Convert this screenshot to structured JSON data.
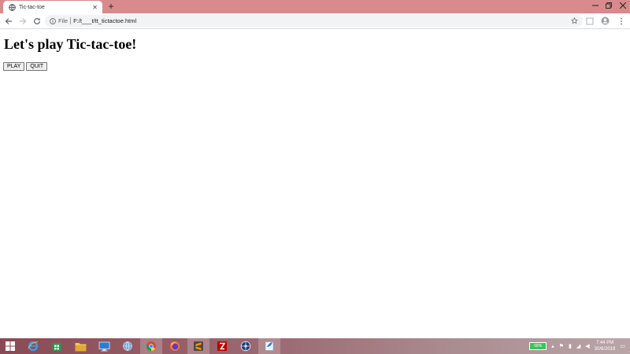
{
  "browser": {
    "tab_title": "Tic-tac-toe",
    "new_tab_symbol": "+",
    "url_scheme": "File",
    "url": "F:/t___t/tt_tictactoe.html"
  },
  "page": {
    "heading": "Let's play Tic-tac-toe!",
    "buttons": {
      "play": "PLAY",
      "quit": "QUIT"
    }
  },
  "taskbar": {
    "battery_percent": "68%",
    "clock_time": "7:44 PM",
    "clock_date": "30/6/2019",
    "apps": [
      "windows-start",
      "internet-explorer",
      "store",
      "file-explorer",
      "remote-desktop",
      "network",
      "chrome",
      "firefox",
      "sublime-text",
      "filezilla",
      "steering",
      "notepad"
    ]
  },
  "colors": {
    "titlebar": "#d98a8c",
    "chrome_bg": "#ffffff",
    "omnibox": "#f1f3f4"
  }
}
